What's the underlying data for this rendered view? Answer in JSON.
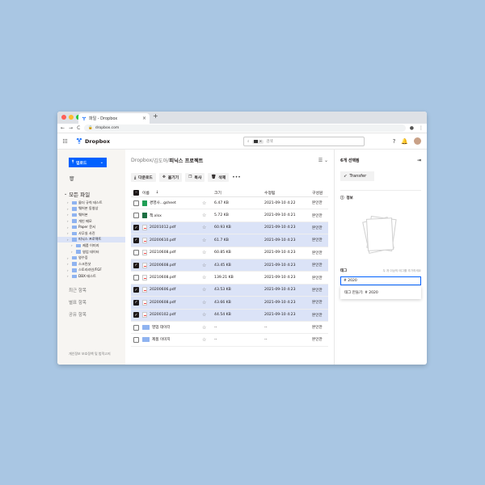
{
  "browser": {
    "tab_title": "파일 - Dropbox",
    "tab_close": "×",
    "new_tab": "+",
    "url": "dropbox.com",
    "nav_back": "←",
    "nav_fwd": "→",
    "nav_reload": "C"
  },
  "header": {
    "brand": "Dropbox",
    "search_chip": "×",
    "search_placeholder": "검색"
  },
  "sidebar": {
    "upload_label": "업로드",
    "trash_icon": "🗑",
    "all_files": "모든 파일",
    "tree": [
      {
        "label": "물더 규칙 테스트",
        "depth": 1,
        "selected": false
      },
      {
        "label": "웨어본 동영상",
        "depth": 1,
        "selected": false
      },
      {
        "label": "웨어본",
        "depth": 1,
        "selected": false
      },
      {
        "label": "개인 메모",
        "depth": 1,
        "selected": false
      },
      {
        "label": "Paper 문서",
        "depth": 1,
        "selected": false
      },
      {
        "label": "사무실 사진",
        "depth": 1,
        "selected": false
      },
      {
        "label": "피닉스 프로젝트",
        "depth": 1,
        "selected": true
      },
      {
        "label": "제품 이미지",
        "depth": 2,
        "selected": false
      },
      {
        "label": "영업 데이터",
        "depth": 2,
        "selected": false
      },
      {
        "label": "영수증",
        "depth": 1,
        "selected": false
      },
      {
        "label": "스크린샷",
        "depth": 1,
        "selected": false
      },
      {
        "label": "스토리라인/FGF",
        "depth": 1,
        "selected": false
      },
      {
        "label": "DBX 테스트",
        "depth": 1,
        "selected": false
      }
    ],
    "nav": [
      "최근 항목",
      "별표 항목",
      "공유 항목"
    ],
    "footer": "개인정보 보호정책 및 법적고지"
  },
  "main": {
    "breadcrumb": {
      "root": "Dropbox",
      "sep1": " / ",
      "mid": "김도아",
      "sep2": " / ",
      "current": "피닉스 프로젝트"
    },
    "actions": [
      {
        "label": "다운로드",
        "icon": "⤓"
      },
      {
        "label": "옮기기",
        "icon": "✥"
      },
      {
        "label": "복사",
        "icon": "❐"
      },
      {
        "label": "삭제",
        "icon": "🗑"
      }
    ],
    "more": "•••",
    "columns": {
      "name": "이름",
      "size": "크기",
      "modified": "수정됨",
      "members": "구성원"
    },
    "rows": [
      {
        "name": "경영사...gsheet",
        "type": "gs",
        "size": "6.47 KB",
        "modified": "2021-09-10 4:22",
        "members": "본인만",
        "checked": false
      },
      {
        "name": "책.xlsx",
        "type": "xl",
        "size": "5.72 KB",
        "modified": "2021-09-10 4:21",
        "members": "본인만",
        "checked": false
      },
      {
        "name": "20201012.pdf",
        "type": "pdf",
        "size": "60.93 KB",
        "modified": "2021-09-10 4:23",
        "members": "본인만",
        "checked": true
      },
      {
        "name": "20200610.pdf",
        "type": "pdf",
        "size": "61.7 KB",
        "modified": "2021-09-10 4:23",
        "members": "본인만",
        "checked": true
      },
      {
        "name": "20210608.pdf",
        "type": "pdf",
        "size": "60.85 KB",
        "modified": "2021-09-10 4:23",
        "members": "본인만",
        "checked": false
      },
      {
        "name": "20200608.pdf",
        "type": "pdf",
        "size": "43.45 KB",
        "modified": "2021-09-10 4:23",
        "members": "본인만",
        "checked": true
      },
      {
        "name": "20210608.pdf",
        "type": "pdf",
        "size": "139.21 KB",
        "modified": "2021-09-10 4:23",
        "members": "본인만",
        "checked": false
      },
      {
        "name": "20200606.pdf",
        "type": "pdf",
        "size": "43.53 KB",
        "modified": "2021-09-10 4:23",
        "members": "본인만",
        "checked": true
      },
      {
        "name": "20200608.pdf",
        "type": "pdf",
        "size": "43.66 KB",
        "modified": "2021-09-10 4:23",
        "members": "본인만",
        "checked": true
      },
      {
        "name": "20200102.pdf",
        "type": "pdf",
        "size": "44.54 KB",
        "modified": "2021-09-10 4:23",
        "members": "본인만",
        "checked": true
      },
      {
        "name": "영업 데이터",
        "type": "folder",
        "size": "--",
        "modified": "--",
        "members": "본인만",
        "checked": false
      },
      {
        "name": "제품 이미지",
        "type": "folder",
        "size": "--",
        "modified": "--",
        "members": "본인만",
        "checked": false
      }
    ]
  },
  "panel": {
    "title": "6개 선택됨",
    "transfer": "Transfer",
    "info": "정보",
    "tag_label": "태그",
    "tag_hint": "두 개 이상의 태그를 추가하세요",
    "tag_value": "# 2020",
    "tag_suggestion": "태그 만들기: # 2020"
  },
  "colors": {
    "accent": "#0061fe",
    "selected_row": "#dbe3f7",
    "background": "#a9c6e3"
  }
}
